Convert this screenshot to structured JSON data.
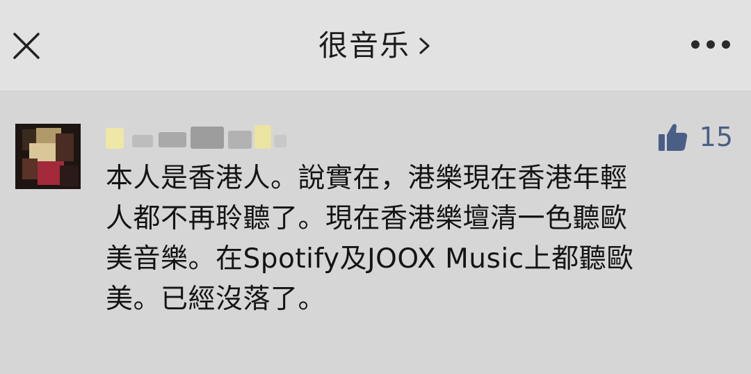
{
  "header": {
    "title": "很音乐",
    "close_icon": "close-icon",
    "chevron_icon": "chevron-right-icon",
    "more_icon": "more-horizontal-icon"
  },
  "comment": {
    "like_icon": "thumbs-up-icon",
    "like_count": "15",
    "like_color": "#4a5f86",
    "text_lines": [
      "本人是香港人。說實在，港樂現在香港年輕",
      "人都不再聆聽了。現在香港樂壇清一色聽歐",
      "美音樂。在Spotify及JOOX Music上都聽歐",
      "美。已經沒落了。"
    ]
  }
}
